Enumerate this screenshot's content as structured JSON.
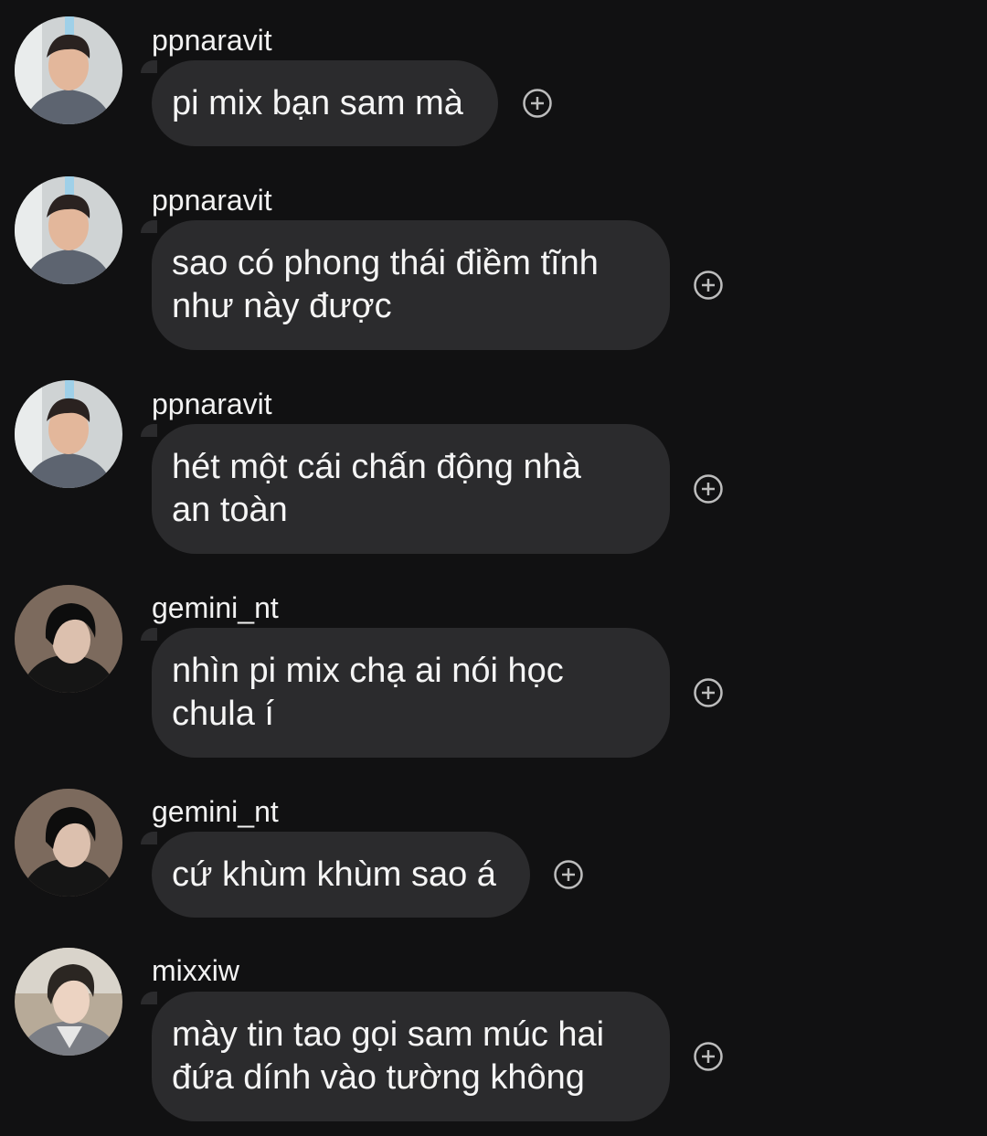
{
  "messages": [
    {
      "user": "ppnaravit",
      "text": "pi mix bạn sam mà",
      "avatar": "ppnaravit-avatar"
    },
    {
      "user": "ppnaravit",
      "text": "sao có phong thái điềm tĩnh\nnhư này được",
      "avatar": "ppnaravit-avatar"
    },
    {
      "user": "ppnaravit",
      "text": "hét một cái chấn động nhà\nan toàn",
      "avatar": "ppnaravit-avatar"
    },
    {
      "user": "gemini_nt",
      "text": "nhìn pi mix chạ ai nói học\nchula í",
      "avatar": "gemini-nt-avatar"
    },
    {
      "user": "gemini_nt",
      "text": "cứ khùm khùm sao á",
      "avatar": "gemini-nt-avatar"
    },
    {
      "user": "mixxiw",
      "text": "mày tin tao gọi sam múc hai\nđứa dính vào tường không",
      "avatar": "mixxiw-avatar"
    }
  ],
  "icons": {
    "react": "add-reaction-icon"
  },
  "colors": {
    "background": "#111112",
    "bubble": "#2b2b2d",
    "text": "#f5f5f5",
    "icon": "#bdbdbd"
  }
}
